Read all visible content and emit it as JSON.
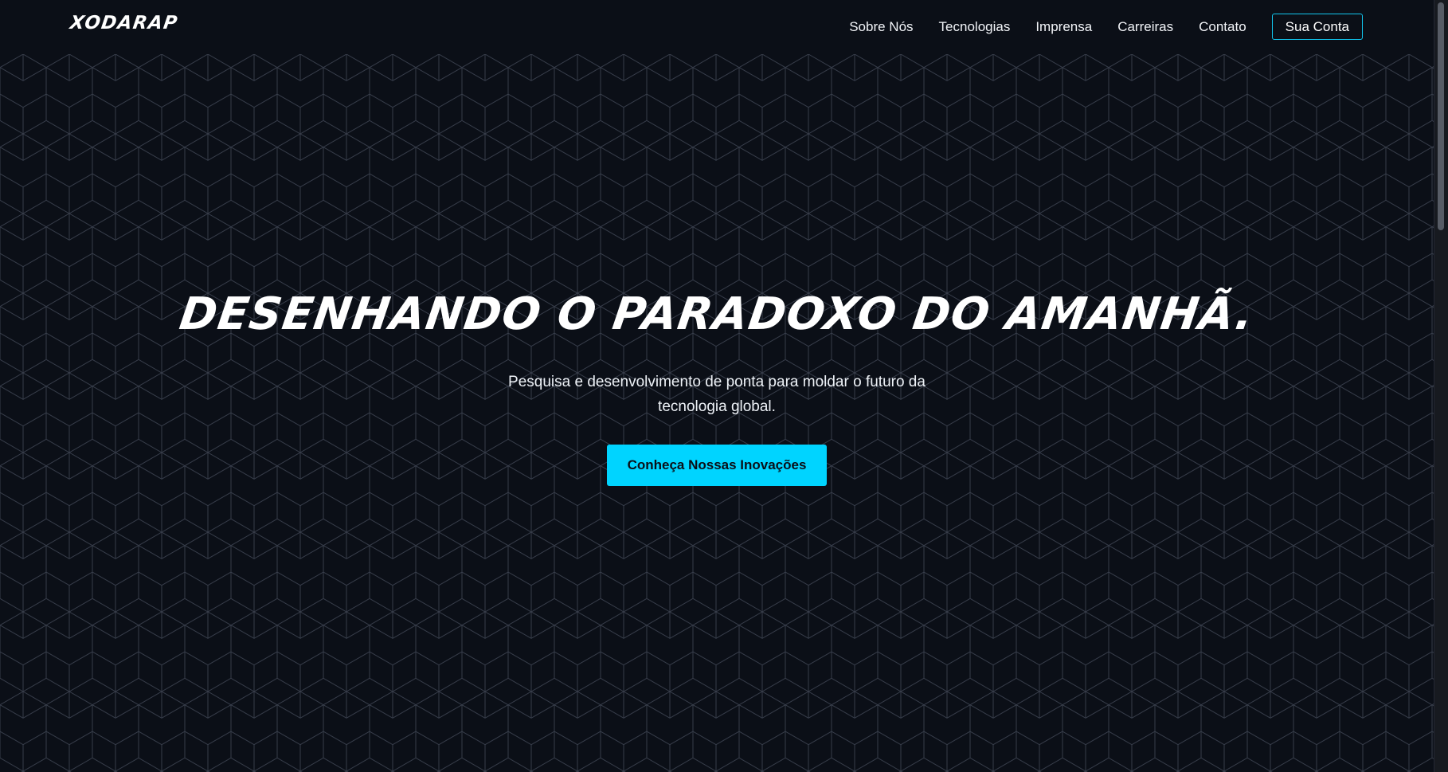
{
  "brand": {
    "logo_text": "XODARAP"
  },
  "nav": {
    "items": [
      {
        "label": "Sobre Nós"
      },
      {
        "label": "Tecnologias"
      },
      {
        "label": "Imprensa"
      },
      {
        "label": "Carreiras"
      },
      {
        "label": "Contato"
      }
    ],
    "account_label": "Sua Conta"
  },
  "hero": {
    "headline": "DESENHANDO O PARADOXO DO AMANHÃ.",
    "subtitle": "Pesquisa e desenvolvimento de ponta para moldar o futuro da tecnologia global.",
    "cta_label": "Conheça Nossas Inovações"
  },
  "colors": {
    "background": "#0b0f17",
    "accent": "#00d4ff",
    "text": "#ffffff",
    "pattern": "#3c4250"
  }
}
